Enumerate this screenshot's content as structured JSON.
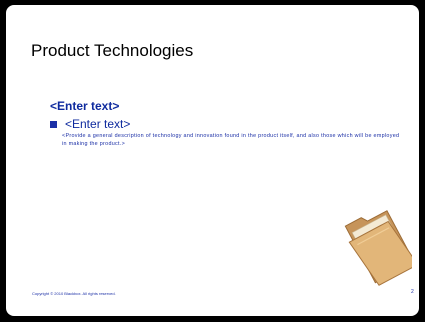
{
  "slide": {
    "title": "Product Technologies",
    "subheading": "<Enter text>",
    "bullet": "<Enter text>",
    "description": "<Provide a general description of technology and innovation found in the product itself, and also those which will be employed in making the product.>",
    "footer_copyright": "Copyright © 2010 Blackbox. All rights reserved.",
    "page_number": "2",
    "folder_icon": "folder-icon"
  },
  "colors": {
    "background": "#000000",
    "slide": "#ffffff",
    "accent": "#1b2fa6"
  }
}
